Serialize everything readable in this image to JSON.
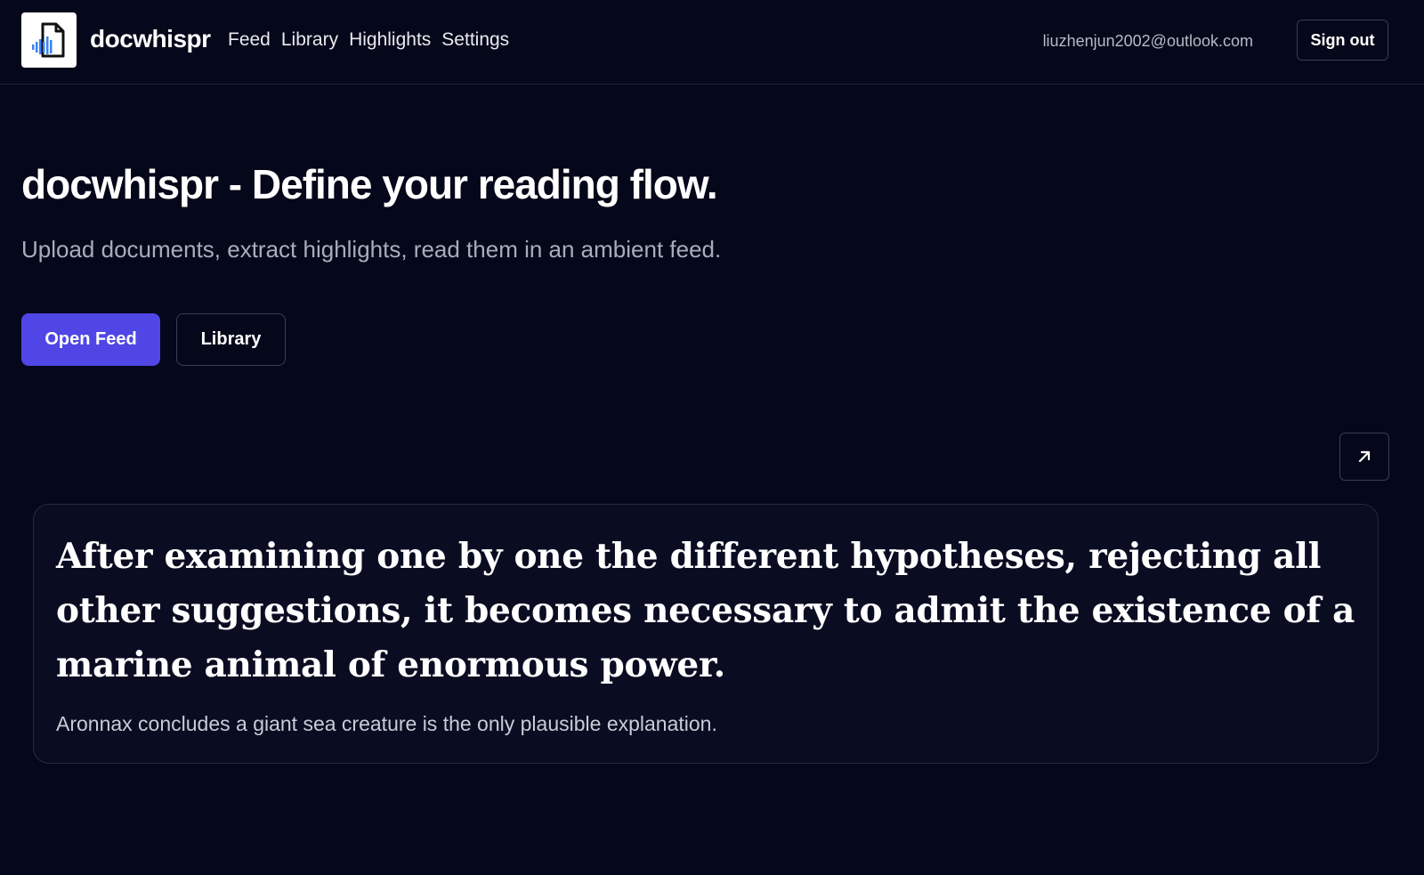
{
  "header": {
    "brand": "docwhispr",
    "logo_icon": "document-audio-icon",
    "nav": {
      "feed": "Feed",
      "library": "Library",
      "highlights": "Highlights",
      "settings": "Settings"
    },
    "user_email": "liuzhenjun2002@outlook.com",
    "sign_out_label": "Sign out"
  },
  "hero": {
    "title": "docwhispr - Define your reading flow.",
    "subtitle": "Upload documents, extract highlights, read them in an ambient feed.",
    "primary_button": "Open Feed",
    "secondary_button": "Library"
  },
  "highlight_card": {
    "expand_icon": "arrow-up-right-icon",
    "quote": "After examining one by one the different hypotheses, rejecting all other suggestions, it becomes necessary to admit the existence of a marine animal of enormous power.",
    "note": "Aronnax concludes a giant sea creature is the only plausible explanation."
  },
  "colors": {
    "background": "#05071a",
    "card_background": "#0a0d22",
    "accent": "#4f46e5",
    "logo_accent": "#3b82f6"
  }
}
